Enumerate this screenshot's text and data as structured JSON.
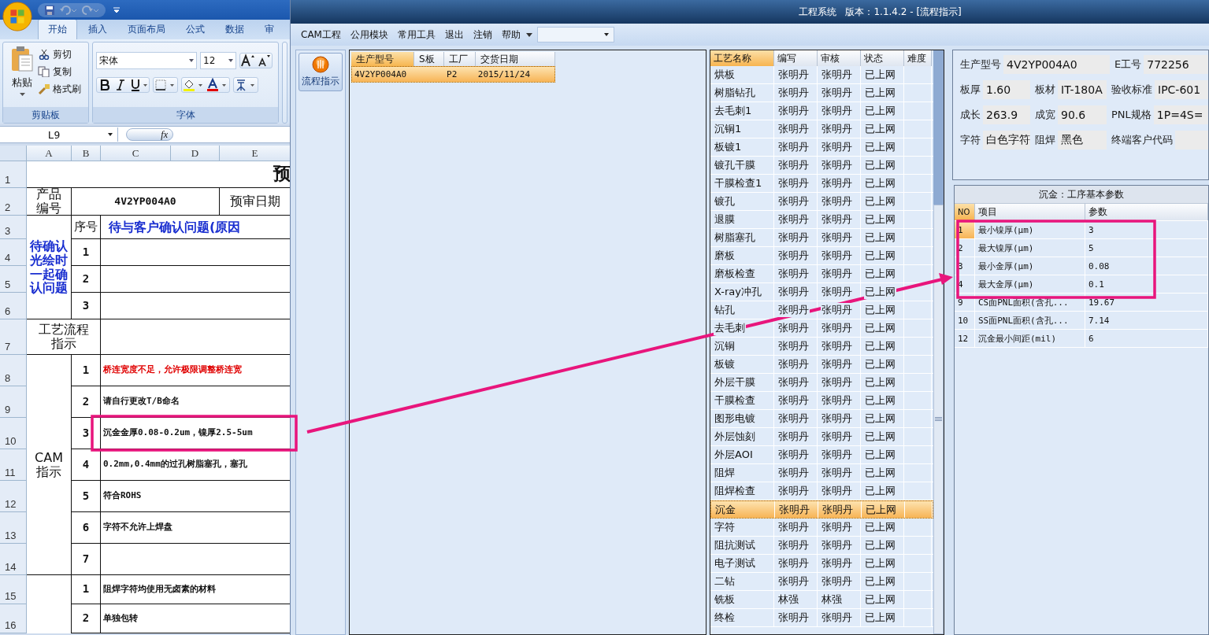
{
  "excel": {
    "tabs": [
      {
        "label": "开始",
        "selected": true
      },
      {
        "label": "插入",
        "selected": false
      },
      {
        "label": "页面布局",
        "selected": false
      },
      {
        "label": "公式",
        "selected": false
      },
      {
        "label": "数据",
        "selected": false
      },
      {
        "label": "审",
        "selected": false
      }
    ],
    "clipboard": {
      "paste": "粘贴",
      "commands": [
        "剪切",
        "复制",
        "格式刷"
      ],
      "group": "剪贴板"
    },
    "font": {
      "family": "宋体",
      "size": "12",
      "group": "字体"
    },
    "name_box": "L9",
    "function_label": "fx",
    "columns": [
      "A",
      "B",
      "C",
      "D",
      "E"
    ],
    "row_numbers": [
      "1",
      "2",
      "3",
      "4",
      "5",
      "6",
      "7",
      "8",
      "9",
      "10",
      "11",
      "12",
      "13",
      "14",
      "15",
      "16"
    ],
    "sheet": {
      "title": "预",
      "product": {
        "label_lines": [
          "产品",
          "编号"
        ],
        "value": "4V2YP004A0",
        "date_label": "预审日期"
      },
      "confirm": {
        "label_lines": [
          "待确认",
          "光绘时",
          "一起确",
          "认问题"
        ],
        "seq_header": "序号",
        "header": "待与客户确认问题(原因",
        "items": [
          "1",
          "2",
          "3"
        ]
      },
      "flow": {
        "label_lines": [
          "工艺流程",
          "指示"
        ]
      },
      "cam": {
        "label_lines": [
          "CAM",
          "指示"
        ],
        "items": [
          {
            "no": "1",
            "text": "桥连宽度不足，允许极限调整桥连宽",
            "kind": "warning"
          },
          {
            "no": "2",
            "text": "请自行更改T/B命名",
            "kind": "normal"
          },
          {
            "no": "3",
            "text": "沉金金厚0.08-0.2um，镍厚2.5-5um",
            "kind": "normal"
          },
          {
            "no": "4",
            "text": "0.2mm,0.4mm的过孔树脂塞孔，塞孔",
            "kind": "normal"
          },
          {
            "no": "5",
            "text": "符合ROHS",
            "kind": "normal"
          },
          {
            "no": "6",
            "text": "字符不允许上焊盘",
            "kind": "normal"
          },
          {
            "no": "7",
            "kind": "normal"
          }
        ]
      },
      "other": {
        "items": [
          {
            "no": "1",
            "text": "阻焊字符均使用无卤素的材料"
          },
          {
            "no": "2",
            "text": "单独包转"
          }
        ]
      }
    }
  },
  "app": {
    "title": "工程系统   版本：1.1.4.2 - [流程指示]",
    "menu": [
      "CAM工程",
      "公用模块",
      "常用工具",
      "退出",
      "注销",
      "帮助"
    ],
    "nav": {
      "label": "流程指示"
    }
  },
  "orders": {
    "columns": [
      {
        "label": "生产型号",
        "selected": true
      },
      {
        "label": "S板",
        "selected": false
      },
      {
        "label": "工厂",
        "selected": false
      },
      {
        "label": "交货日期",
        "selected": false
      }
    ],
    "rows": [
      {
        "model": "4V2YP004A0",
        "factory": "P2",
        "date": "2015/11/24",
        "selected": true
      }
    ]
  },
  "processes": {
    "columns": [
      {
        "label": "工艺名称",
        "selected": true
      },
      {
        "label": "编写",
        "selected": false
      },
      {
        "label": "审核",
        "selected": false
      },
      {
        "label": "状态",
        "selected": false
      },
      {
        "label": "难度",
        "selected": false
      }
    ],
    "rows": [
      {
        "name": "烘板",
        "author": "张明丹",
        "reviewer": "张明丹",
        "status": "已上网",
        "selected": false
      },
      {
        "name": "树脂钻孔",
        "author": "张明丹",
        "reviewer": "张明丹",
        "status": "已上网",
        "selected": false
      },
      {
        "name": "去毛刺1",
        "author": "张明丹",
        "reviewer": "张明丹",
        "status": "已上网",
        "selected": false
      },
      {
        "name": "沉铜1",
        "author": "张明丹",
        "reviewer": "张明丹",
        "status": "已上网",
        "selected": false
      },
      {
        "name": "板镀1",
        "author": "张明丹",
        "reviewer": "张明丹",
        "status": "已上网",
        "selected": false
      },
      {
        "name": "镀孔干膜",
        "author": "张明丹",
        "reviewer": "张明丹",
        "status": "已上网",
        "selected": false
      },
      {
        "name": "干膜检查1",
        "author": "张明丹",
        "reviewer": "张明丹",
        "status": "已上网",
        "selected": false
      },
      {
        "name": "镀孔",
        "author": "张明丹",
        "reviewer": "张明丹",
        "status": "已上网",
        "selected": false
      },
      {
        "name": "退膜",
        "author": "张明丹",
        "reviewer": "张明丹",
        "status": "已上网",
        "selected": false
      },
      {
        "name": "树脂塞孔",
        "author": "张明丹",
        "reviewer": "张明丹",
        "status": "已上网",
        "selected": false
      },
      {
        "name": "磨板",
        "author": "张明丹",
        "reviewer": "张明丹",
        "status": "已上网",
        "selected": false
      },
      {
        "name": "磨板检查",
        "author": "张明丹",
        "reviewer": "张明丹",
        "status": "已上网",
        "selected": false
      },
      {
        "name": "X-ray冲孔",
        "author": "张明丹",
        "reviewer": "张明丹",
        "status": "已上网",
        "selected": false
      },
      {
        "name": "钻孔",
        "author": "张明丹",
        "reviewer": "张明丹",
        "status": "已上网",
        "selected": false
      },
      {
        "name": "去毛刺",
        "author": "张明丹",
        "reviewer": "张明丹",
        "status": "已上网",
        "selected": false
      },
      {
        "name": "沉铜",
        "author": "张明丹",
        "reviewer": "张明丹",
        "status": "已上网",
        "selected": false
      },
      {
        "name": "板镀",
        "author": "张明丹",
        "reviewer": "张明丹",
        "status": "已上网",
        "selected": false
      },
      {
        "name": "外层干膜",
        "author": "张明丹",
        "reviewer": "张明丹",
        "status": "已上网",
        "selected": false
      },
      {
        "name": "干膜检查",
        "author": "张明丹",
        "reviewer": "张明丹",
        "status": "已上网",
        "selected": false
      },
      {
        "name": "图形电镀",
        "author": "张明丹",
        "reviewer": "张明丹",
        "status": "已上网",
        "selected": false
      },
      {
        "name": "外层蚀刻",
        "author": "张明丹",
        "reviewer": "张明丹",
        "status": "已上网",
        "selected": false
      },
      {
        "name": "外层AOI",
        "author": "张明丹",
        "reviewer": "张明丹",
        "status": "已上网",
        "selected": false
      },
      {
        "name": "阻焊",
        "author": "张明丹",
        "reviewer": "张明丹",
        "status": "已上网",
        "selected": false
      },
      {
        "name": "阻焊检查",
        "author": "张明丹",
        "reviewer": "张明丹",
        "status": "已上网",
        "selected": false
      },
      {
        "name": "沉金",
        "author": "张明丹",
        "reviewer": "张明丹",
        "status": "已上网",
        "selected": true
      },
      {
        "name": "字符",
        "author": "张明丹",
        "reviewer": "张明丹",
        "status": "已上网",
        "selected": false
      },
      {
        "name": "阻抗测试",
        "author": "张明丹",
        "reviewer": "张明丹",
        "status": "已上网",
        "selected": false
      },
      {
        "name": "电子测试",
        "author": "张明丹",
        "reviewer": "张明丹",
        "status": "已上网",
        "selected": false
      },
      {
        "name": "二钻",
        "author": "张明丹",
        "reviewer": "张明丹",
        "status": "已上网",
        "selected": false
      },
      {
        "name": "铣板",
        "author": "林强",
        "reviewer": "林强",
        "status": "已上网",
        "selected": false
      },
      {
        "name": "终检",
        "author": "张明丹",
        "reviewer": "张明丹",
        "status": "已上网",
        "selected": false
      }
    ]
  },
  "info": {
    "model": {
      "label": "生产型号",
      "value": "4V2YP004A0"
    },
    "staff": {
      "label": "E工号",
      "value": "772256"
    },
    "rows": [
      [
        {
          "label": "板厚",
          "value": "1.60"
        },
        {
          "label": "板材",
          "value": "IT-180A"
        },
        {
          "label": "验收标准",
          "value": "IPC-601"
        }
      ],
      [
        {
          "label": "成长",
          "value": "263.9"
        },
        {
          "label": "成宽",
          "value": "90.6"
        },
        {
          "label": "PNL规格",
          "value": "1P=4S="
        }
      ],
      [
        {
          "label": "字符",
          "value": "白色字符"
        },
        {
          "label": "阻焊",
          "value": "黑色"
        },
        {
          "label": "终端客户代码"
        }
      ]
    ]
  },
  "params": {
    "title": "沉金：工序基本参数",
    "columns": [
      {
        "label": "NO",
        "selected": true
      },
      {
        "label": "项目",
        "selected": false
      },
      {
        "label": "参数",
        "selected": false
      }
    ],
    "rows": [
      {
        "no": "1",
        "item": "最小镍厚(μm)",
        "value": "3",
        "selected": true
      },
      {
        "no": "2",
        "item": "最大镍厚(μm)",
        "value": "5",
        "selected": false
      },
      {
        "no": "3",
        "item": "最小金厚(μm)",
        "value": "0.08",
        "selected": false
      },
      {
        "no": "4",
        "item": "最大金厚(μm)",
        "value": "0.1",
        "selected": false
      },
      {
        "no": "9",
        "item": "CS面PNL面积(含孔...",
        "value": "19.67",
        "selected": false
      },
      {
        "no": "10",
        "item": "SS面PNL面积(含孔...",
        "value": "7.14",
        "selected": false
      },
      {
        "no": "12",
        "item": "沉金最小间距(mil)",
        "value": "6",
        "selected": false
      }
    ]
  }
}
